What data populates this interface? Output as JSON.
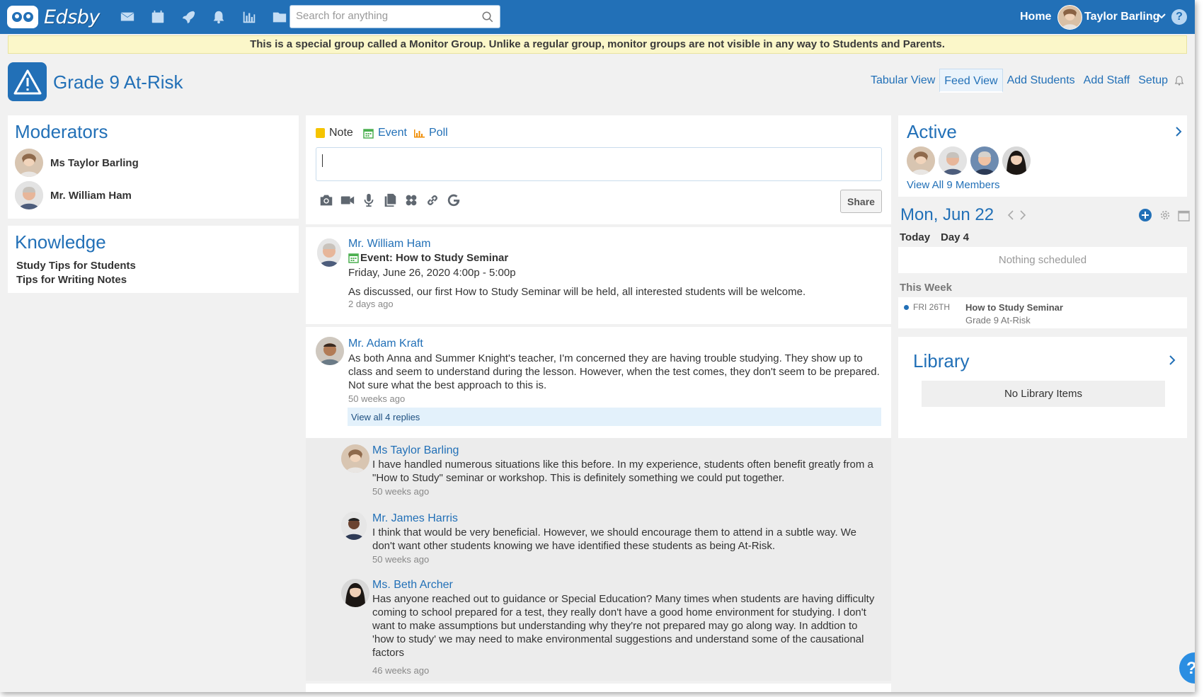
{
  "app": {
    "logo_text": "Edsby"
  },
  "topbar": {
    "nav_icons": [
      "mail-icon",
      "calendar-icon",
      "rocket-icon",
      "bell-icon",
      "chart-icon",
      "folder-icon"
    ],
    "search_placeholder": "Search for anything",
    "home_label": "Home",
    "user_name": "Taylor Barling",
    "help_label": "?"
  },
  "banner": {
    "text": "This is a special group called a Monitor Group. Unlike a regular group, monitor groups are not visible in any way to Students and Parents."
  },
  "group": {
    "title": "Grade 9 At-Risk"
  },
  "header_nav": {
    "tabular_view": "Tabular View",
    "feed_view": "Feed View",
    "add_students": "Add Students",
    "add_staff": "Add Staff",
    "setup": "Setup"
  },
  "moderators": {
    "title": "Moderators",
    "items": [
      {
        "name": "Ms Taylor Barling"
      },
      {
        "name": "Mr. William Ham"
      }
    ]
  },
  "knowledge": {
    "title": "Knowledge",
    "items": [
      "Study Tips for Students",
      "Tips for Writing Notes"
    ]
  },
  "composer": {
    "types": {
      "note": "Note",
      "event": "Event",
      "poll": "Poll"
    },
    "tools": [
      "camera-icon",
      "video-icon",
      "microphone-icon",
      "documents-icon",
      "dropbox-icon",
      "link-icon",
      "google-icon"
    ],
    "share_label": "Share"
  },
  "posts": [
    {
      "author": "Mr. William Ham",
      "event_prefix": "Event:",
      "event_title": "How to Study Seminar",
      "event_time": "Friday, June 26, 2020 4:00p - 5:00p",
      "text": "As discussed, our first How to Study Seminar will be held, all interested students will be welcome.",
      "time": "2 days ago"
    },
    {
      "author": "Mr. Adam Kraft",
      "text": "As both Anna and Summer Knight's teacher, I'm concerned they are having trouble studying. They show up to class and seem to understand during the lesson. However, when the test comes, they don't seem to be prepared. Not sure what the best approach to this is.",
      "time": "50 weeks ago",
      "view_replies": "View all 4 replies"
    }
  ],
  "replies": [
    {
      "author": "Ms Taylor Barling",
      "text": "I have handled numerous situations like this before. In my experience, students often benefit greatly from a \"How to Study\" seminar or workshop. This is definitely something we could put together.",
      "time": "50 weeks ago"
    },
    {
      "author": "Mr. James Harris",
      "text": "I think that would be very beneficial. However, we should encourage them to attend in a subtle way. We don't want other students knowing we have identified these students as being At-Risk.",
      "time": "50 weeks ago"
    },
    {
      "author": "Ms. Beth Archer",
      "text": "Has anyone reached out to guidance or Special Education?  Many times when students are having difficulty coming to school prepared for a test, they really don't have a good home environment for studying.  I don't want to make assumptions but understanding why they're not prepared may go along way.  In addtion to 'how to study' we may need to make environmental suggestions and understand some of the causational factors",
      "time": "46 weeks ago"
    }
  ],
  "active": {
    "title": "Active",
    "view_all": "View All 9 Members"
  },
  "calendar": {
    "date": "Mon, Jun 22",
    "today": "Today",
    "day": "Day 4",
    "nothing": "Nothing scheduled",
    "this_week": "This Week",
    "event_day": "FRI 26TH",
    "event_title": "How to Study Seminar",
    "event_group": "Grade 9 At-Risk"
  },
  "library": {
    "title": "Library",
    "empty": "No Library Items"
  },
  "colors": {
    "brand": "#2270b7",
    "banner": "#fbf7c9",
    "note": "#f5c400",
    "event": "#4caf50",
    "poll": "#f08c00"
  }
}
